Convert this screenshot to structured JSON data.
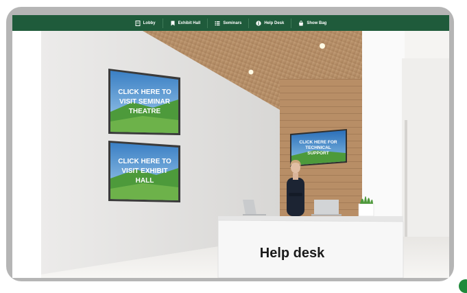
{
  "nav": {
    "items": [
      {
        "label": "Lobby",
        "icon": "building-icon"
      },
      {
        "label": "Exhibit Hall",
        "icon": "bookmark-icon"
      },
      {
        "label": "Seminars",
        "icon": "list-icon"
      },
      {
        "label": "Help Desk",
        "icon": "info-icon"
      },
      {
        "label": "Show Bag",
        "icon": "bag-icon"
      }
    ],
    "bg": "#1f5b3b"
  },
  "scene": {
    "seminar_sign": [
      "CLICK HERE TO",
      "VISIT SEMINAR",
      "THEATRE"
    ],
    "exhibit_sign": [
      "CLICK HERE TO",
      "VISIT EXHIBIT",
      "HALL"
    ],
    "support_sign": [
      "CLICK HERE FOR",
      "TECHNICAL",
      "SUPPORT"
    ],
    "desk_label": "Help desk"
  }
}
